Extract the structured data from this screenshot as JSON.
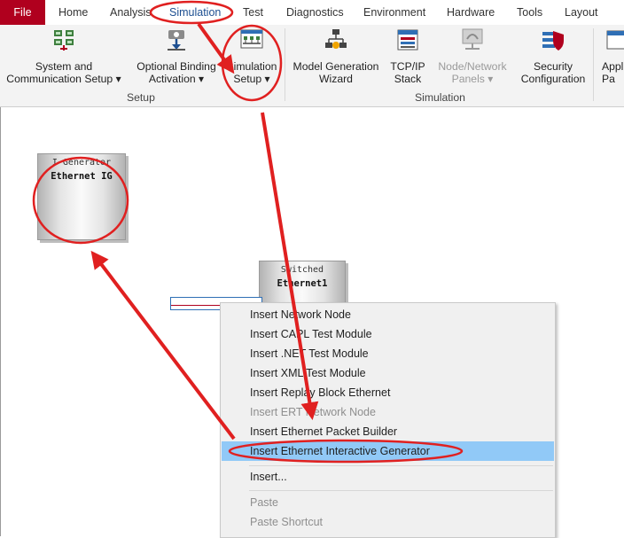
{
  "tabs": [
    {
      "label": "File"
    },
    {
      "label": "Home"
    },
    {
      "label": "Analysis"
    },
    {
      "label": "Simulation"
    },
    {
      "label": "Test"
    },
    {
      "label": "Diagnostics"
    },
    {
      "label": "Environment"
    },
    {
      "label": "Hardware"
    },
    {
      "label": "Tools"
    },
    {
      "label": "Layout"
    }
  ],
  "active_tab": "Simulation",
  "ribbon": {
    "buttons": [
      {
        "line1": "System and",
        "line2": "Communication Setup ▾",
        "icon": "network-setup-icon"
      },
      {
        "line1": "Optional Binding",
        "line2": "Activation ▾",
        "icon": "download-binding-icon"
      },
      {
        "line1": "Simulation",
        "line2": "Setup ▾",
        "icon": "simulation-setup-icon"
      },
      {
        "line1": "Model Generation",
        "line2": "Wizard",
        "icon": "model-wizard-icon"
      },
      {
        "line1": "TCP/IP",
        "line2": "Stack",
        "icon": "tcpip-stack-icon"
      },
      {
        "line1": "Node/Network",
        "line2": "Panels ▾",
        "icon": "node-panels-icon",
        "disabled": true
      },
      {
        "line1": "Security",
        "line2": "Configuration",
        "icon": "security-shield-icon"
      },
      {
        "line1": "Appl",
        "line2": "Pa",
        "icon": "application-icon"
      }
    ],
    "groups": [
      {
        "label": "Setup"
      },
      {
        "label": "Simulation"
      }
    ]
  },
  "canvas": {
    "nodes": [
      {
        "line1": "I-Generator",
        "line2": "Ethernet IG"
      },
      {
        "line1": "Switched",
        "line2": "Ethernet1"
      }
    ]
  },
  "context_menu": {
    "items": [
      {
        "label": "Insert Network Node"
      },
      {
        "label": "Insert CAPL Test Module"
      },
      {
        "label": "Insert .NET Test Module"
      },
      {
        "label": "Insert XML Test Module"
      },
      {
        "label": "Insert Replay Block Ethernet"
      },
      {
        "label": "Insert ERT Network Node",
        "disabled": true
      },
      {
        "label": "Insert Ethernet Packet Builder"
      },
      {
        "label": "Insert Ethernet Interactive Generator",
        "highlighted": true
      },
      {
        "label": "Insert..."
      },
      {
        "label": "Paste",
        "disabled": true
      },
      {
        "label": "Paste Shortcut",
        "disabled": true
      }
    ]
  },
  "colors": {
    "file_tab": "#b0001e",
    "active_tab_text": "#1d4f91",
    "annotation_red": "#e02020",
    "menu_highlight": "#91c9f7"
  }
}
